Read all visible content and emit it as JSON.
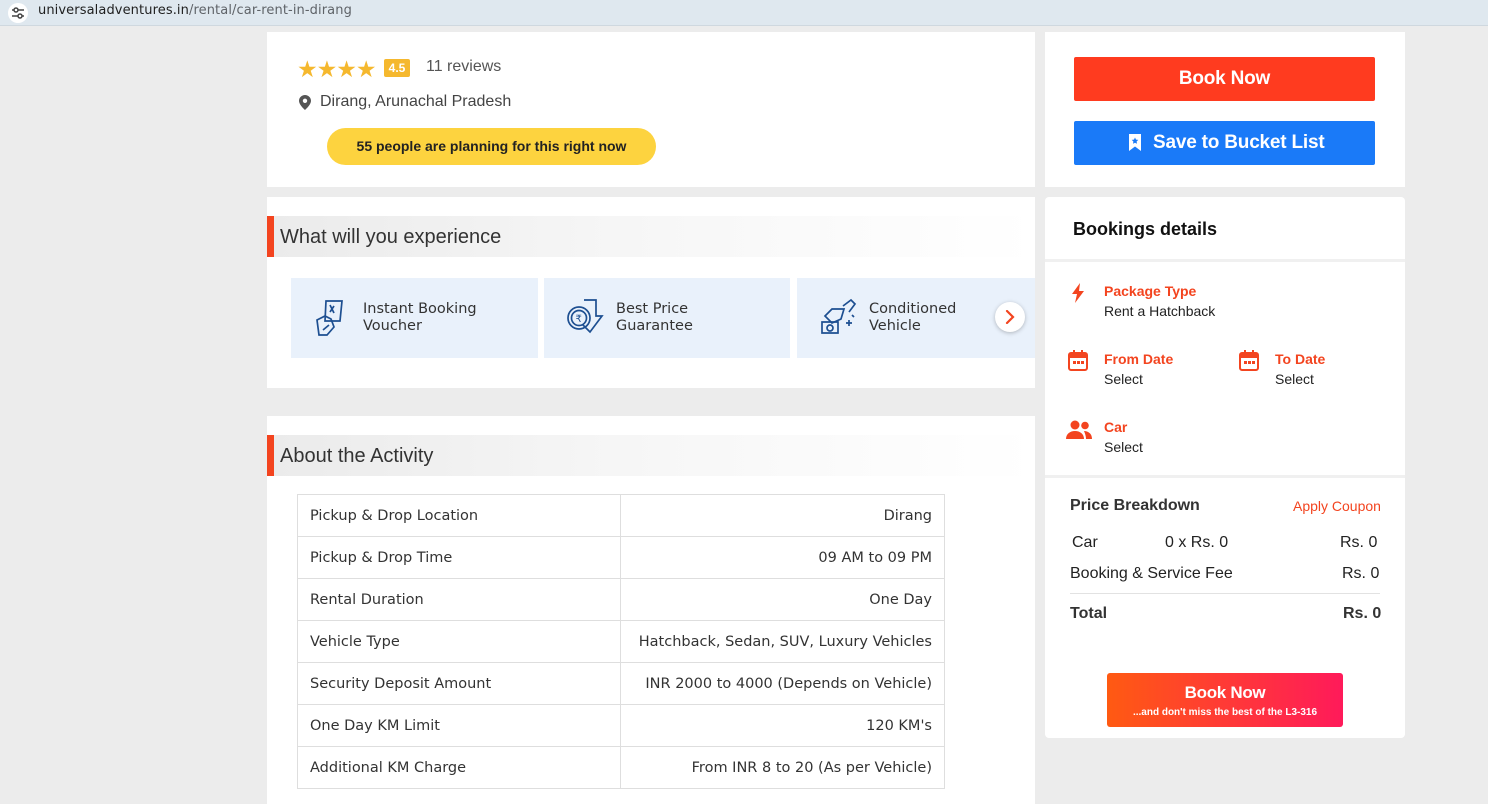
{
  "browser": {
    "url_host": "universaladventures.in",
    "url_path": "/rental/car-rent-in-dirang"
  },
  "header": {
    "stars": "★★★★",
    "rating": "4.5",
    "reviews": "11 reviews",
    "location": "Dirang, Arunachal Pradesh",
    "planning_badge": "55 people are planning for this right now"
  },
  "actions": {
    "book_now": "Book Now",
    "save_bucket": "Save to Bucket List"
  },
  "experience": {
    "title": "What will you experience",
    "features": [
      {
        "line1": "Instant Booking",
        "line2": "Voucher",
        "icon": "voucher-icon"
      },
      {
        "line1": "Best Price",
        "line2": "Guarantee",
        "icon": "rupee-icon"
      },
      {
        "line1": "Conditioned",
        "line2": "Vehicle",
        "icon": "car-key-icon"
      }
    ]
  },
  "about": {
    "title": "About the Activity",
    "rows": [
      {
        "label": "Pickup & Drop Location",
        "value": "Dirang"
      },
      {
        "label": "Pickup & Drop Time",
        "value": "09 AM to 09 PM"
      },
      {
        "label": "Rental Duration",
        "value": "One Day"
      },
      {
        "label": "Vehicle Type",
        "value": "Hatchback, Sedan, SUV, Luxury Vehicles"
      },
      {
        "label": "Security Deposit Amount",
        "value": "INR 2000 to 4000 (Depends on Vehicle)"
      },
      {
        "label": "One Day KM Limit",
        "value": "120 KM's"
      },
      {
        "label": "Additional KM Charge",
        "value": "From INR 8 to 20 (As per Vehicle)"
      }
    ]
  },
  "booking": {
    "title": "Bookings details",
    "package_label": "Package Type",
    "package_value": "Rent a Hatchback",
    "from_label": "From Date",
    "from_value": "Select",
    "to_label": "To Date",
    "to_value": "Select",
    "car_label": "Car",
    "car_value": "Select"
  },
  "price": {
    "title": "Price Breakdown",
    "coupon": "Apply Coupon",
    "car_label": "Car",
    "car_qty": "0 x Rs. 0",
    "car_amount": "Rs. 0",
    "fee_label": "Booking & Service Fee",
    "fee_amount": "Rs. 0",
    "total_label": "Total",
    "total_amount": "Rs. 0"
  },
  "cta": {
    "title": "Book Now",
    "subtitle": "...and don't miss the best of the L3-316"
  },
  "colors": {
    "accent": "#f3441f",
    "book": "#ff3b1f",
    "save": "#1a7af8",
    "badge": "#fdd33f",
    "star": "#f5b82e"
  }
}
